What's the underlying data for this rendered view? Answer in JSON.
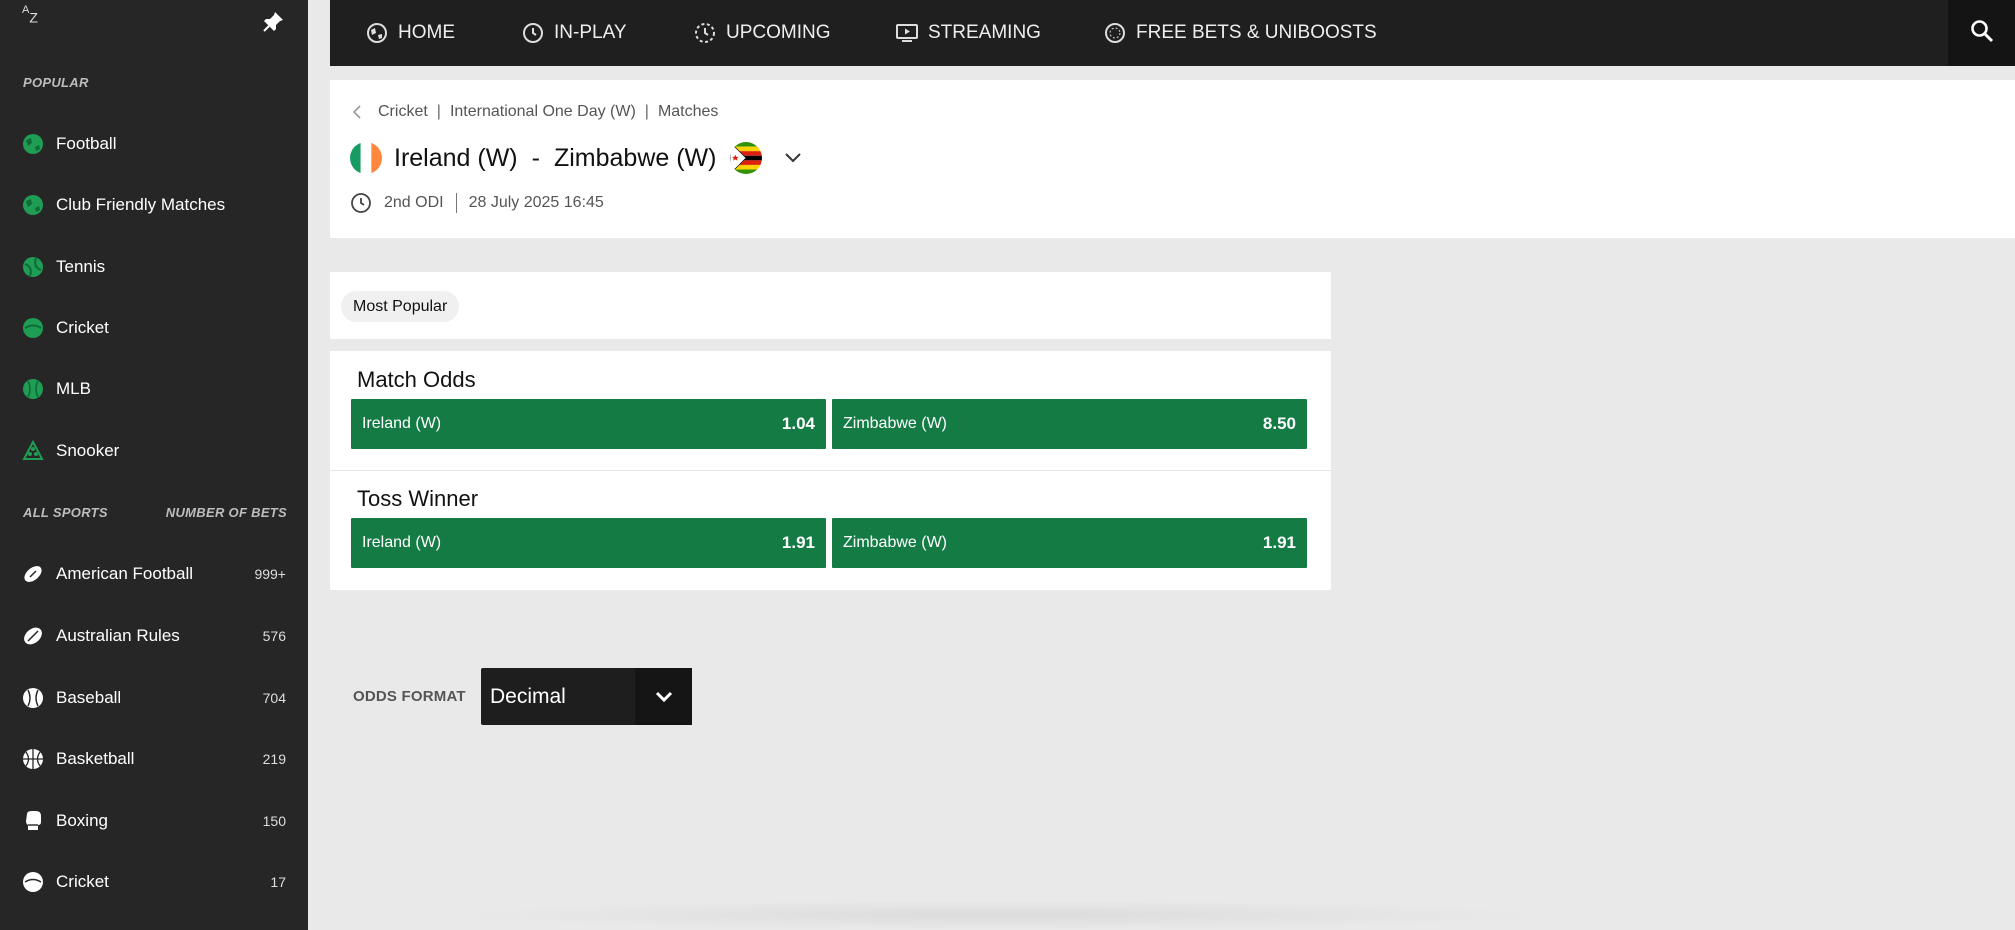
{
  "sidebar": {
    "az_label_a": "A",
    "az_label_z": "Z",
    "popular_label": "POPULAR",
    "popular": [
      {
        "label": "Football",
        "icon": "football-icon"
      },
      {
        "label": "Club Friendly Matches",
        "icon": "football-icon"
      },
      {
        "label": "Tennis",
        "icon": "tennis-icon"
      },
      {
        "label": "Cricket",
        "icon": "cricket-icon"
      },
      {
        "label": "MLB",
        "icon": "baseball-icon"
      },
      {
        "label": "Snooker",
        "icon": "snooker-icon"
      }
    ],
    "all_sports_label": "ALL SPORTS",
    "number_of_bets_label": "NUMBER OF BETS",
    "all_sports": [
      {
        "label": "American Football",
        "count": "999+",
        "icon": "american-football-icon"
      },
      {
        "label": "Australian Rules",
        "count": "576",
        "icon": "australian-rules-icon"
      },
      {
        "label": "Baseball",
        "count": "704",
        "icon": "baseball-icon"
      },
      {
        "label": "Basketball",
        "count": "219",
        "icon": "basketball-icon"
      },
      {
        "label": "Boxing",
        "count": "150",
        "icon": "boxing-icon"
      },
      {
        "label": "Cricket",
        "count": "17",
        "icon": "cricket-icon"
      }
    ]
  },
  "nav": {
    "items": [
      {
        "label": "HOME",
        "icon": "home-icon"
      },
      {
        "label": "IN-PLAY",
        "icon": "clock-icon"
      },
      {
        "label": "UPCOMING",
        "icon": "upcoming-icon"
      },
      {
        "label": "STREAMING",
        "icon": "streaming-icon"
      },
      {
        "label": "FREE BETS & UNIBOOSTS",
        "icon": "free-bets-icon"
      }
    ],
    "search_icon": "search-icon"
  },
  "event": {
    "breadcrumb": [
      "Cricket",
      "International One Day (W)",
      "Matches"
    ],
    "home_team": "Ireland (W)",
    "separator": "-",
    "away_team": "Zimbabwe (W)",
    "stage": "2nd ODI",
    "datetime": "28 July 2025 16:45"
  },
  "tabs": {
    "active": "Most Popular"
  },
  "markets": [
    {
      "title": "Match Odds",
      "outcomes": [
        {
          "label": "Ireland (W)",
          "price": "1.04"
        },
        {
          "label": "Zimbabwe (W)",
          "price": "8.50"
        }
      ]
    },
    {
      "title": "Toss Winner",
      "outcomes": [
        {
          "label": "Ireland (W)",
          "price": "1.91"
        },
        {
          "label": "Zimbabwe (W)",
          "price": "1.91"
        }
      ]
    }
  ],
  "odds_format": {
    "label": "ODDS FORMAT",
    "value": "Decimal"
  },
  "colors": {
    "odds_button": "#147b45",
    "sidebar_bg": "#262626",
    "nav_bg": "#1f1f1f",
    "sport_icon_green": "#1f9d55"
  }
}
